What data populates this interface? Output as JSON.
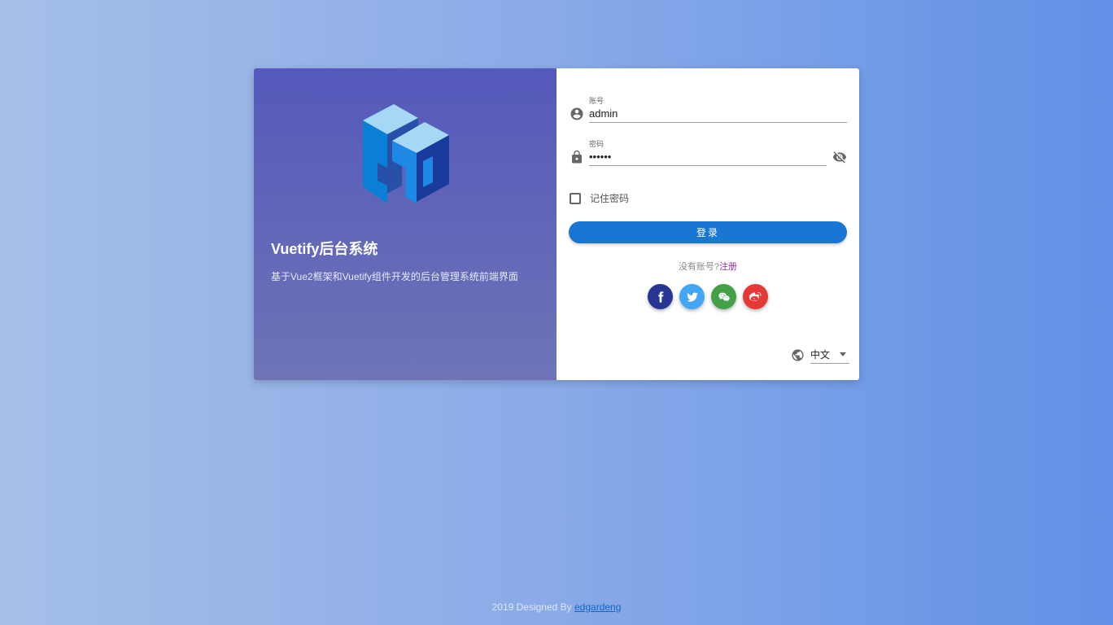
{
  "brand": {
    "title": "Vuetify后台系统",
    "subtitle": "基于Vue2框架和Vuetify组件开发的后台管理系统前端界面",
    "logo_icon": "cube-logo-icon"
  },
  "form": {
    "username": {
      "label": "账号",
      "value": "admin",
      "icon": "account-circle-icon"
    },
    "password": {
      "label": "密码",
      "value": "123456",
      "icon": "lock-icon",
      "toggle_icon": "eye-off-icon"
    },
    "remember_label": "记住密码",
    "remember_checked": false,
    "login_label": "登录",
    "signup_prompt": "没有账号?",
    "signup_link": "注册"
  },
  "socials": [
    {
      "name": "facebook-icon",
      "color": "#283593"
    },
    {
      "name": "twitter-icon",
      "color": "#42a5f5"
    },
    {
      "name": "wechat-icon",
      "color": "#43a047"
    },
    {
      "name": "weibo-icon",
      "color": "#e53935"
    }
  ],
  "language": {
    "icon": "globe-icon",
    "selected": "中文"
  },
  "footer": {
    "prefix": "2019 Designed By ",
    "author": "edgardeng"
  },
  "colors": {
    "primary": "#1976d2",
    "link": "#9c27b0",
    "panel": "#5459bb"
  }
}
